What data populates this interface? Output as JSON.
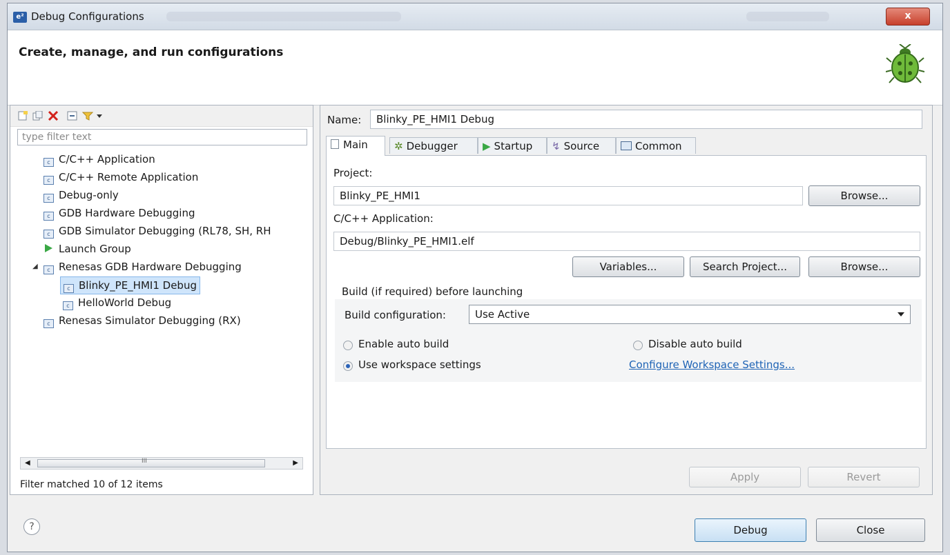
{
  "window": {
    "title": "Debug Configurations",
    "close_glyph": "x"
  },
  "header": {
    "title": "Create, manage, and run configurations",
    "icon": "bug-icon"
  },
  "left": {
    "filter_placeholder": "type filter text",
    "tree": [
      {
        "label": "C/C++ Application",
        "icon": "c-config-icon"
      },
      {
        "label": "C/C++ Remote Application",
        "icon": "c-config-icon"
      },
      {
        "label": "Debug-only",
        "icon": "c-config-icon"
      },
      {
        "label": "GDB Hardware Debugging",
        "icon": "c-config-icon"
      },
      {
        "label": "GDB Simulator Debugging (RL78, SH, RH",
        "icon": "c-config-icon"
      },
      {
        "label": "Launch Group",
        "icon": "launch-group-icon"
      },
      {
        "label": "Renesas GDB Hardware Debugging",
        "icon": "c-config-icon",
        "expanded": true
      },
      {
        "label": "Blinky_PE_HMI1 Debug",
        "icon": "c-config-icon",
        "selected": true
      },
      {
        "label": "HelloWorld Debug",
        "icon": "c-config-icon"
      },
      {
        "label": "Renesas Simulator Debugging (RX)",
        "icon": "c-config-icon"
      }
    ],
    "scroll_thumb_glyph": "III",
    "status": "Filter matched 10 of 12 items"
  },
  "right": {
    "name_label": "Name:",
    "name_value": "Blinky_PE_HMI1 Debug",
    "tabs": [
      {
        "label": "Main",
        "icon": "main-icon",
        "active": true
      },
      {
        "label": "Debugger",
        "icon": "debugger-icon"
      },
      {
        "label": "Startup",
        "icon": "startup-icon"
      },
      {
        "label": "Source",
        "icon": "source-icon"
      },
      {
        "label": "Common",
        "icon": "common-icon"
      }
    ],
    "project_label": "Project:",
    "project_value": "Blinky_PE_HMI1",
    "browse_label": "Browse...",
    "app_label": "C/C++ Application:",
    "app_value": "Debug/Blinky_PE_HMI1.elf",
    "variables_label": "Variables...",
    "search_project_label": "Search Project...",
    "build_group_label": "Build (if required) before launching",
    "build_config_label": "Build configuration:",
    "build_config_value": "Use Active",
    "radios": {
      "enable_auto": "Enable auto build",
      "disable_auto": "Disable auto build",
      "use_workspace": "Use workspace settings",
      "selected": "use_workspace"
    },
    "configure_link": "Configure Workspace Settings...",
    "apply_label": "Apply",
    "revert_label": "Revert"
  },
  "footer": {
    "help_glyph": "?",
    "debug_label": "Debug",
    "close_label": "Close"
  }
}
